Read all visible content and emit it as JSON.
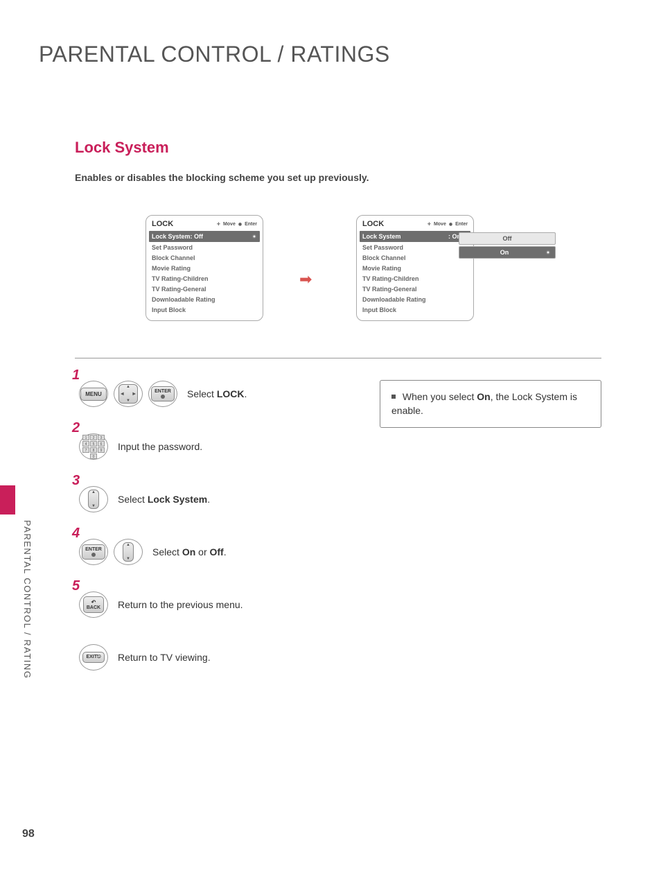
{
  "page_title": "PARENTAL CONTROL / RATINGS",
  "section_title": "Lock System",
  "section_desc": "Enables or disables the blocking scheme you set up previously.",
  "osd": {
    "title": "LOCK",
    "hint_move": "Move",
    "hint_enter": "Enter",
    "lock_system_label": "Lock System",
    "lock_system_off": ": Off",
    "lock_system_on": ": On",
    "items": [
      "Set Password",
      "Block Channel",
      "Movie Rating",
      "TV Rating-Children",
      "TV Rating-General",
      "Downloadable Rating",
      "Input Block"
    ],
    "popup_off": "Off",
    "popup_on": "On"
  },
  "buttons": {
    "menu": "MENU",
    "enter": "ENTER",
    "back": "BACK",
    "exit": "EXIT"
  },
  "steps": {
    "s1_prefix": "Select ",
    "s1_bold": "LOCK",
    "s1_suffix": ".",
    "s2": "Input the password.",
    "s3_prefix": "Select ",
    "s3_bold": "Lock System",
    "s3_suffix": ".",
    "s4_prefix": "Select ",
    "s4_b1": "On",
    "s4_mid": " or ",
    "s4_b2": "Off",
    "s4_suffix": ".",
    "s5": "Return to the previous menu.",
    "s6": "Return to TV viewing."
  },
  "note": {
    "prefix": "When you select ",
    "bold": "On",
    "suffix": ", the Lock System is enable."
  },
  "sidebar": "PARENTAL CONTROL / RATING",
  "page_number": "98",
  "nums": {
    "n1": "1",
    "n2": "2",
    "n3": "3",
    "n4": "4",
    "n5": "5"
  }
}
